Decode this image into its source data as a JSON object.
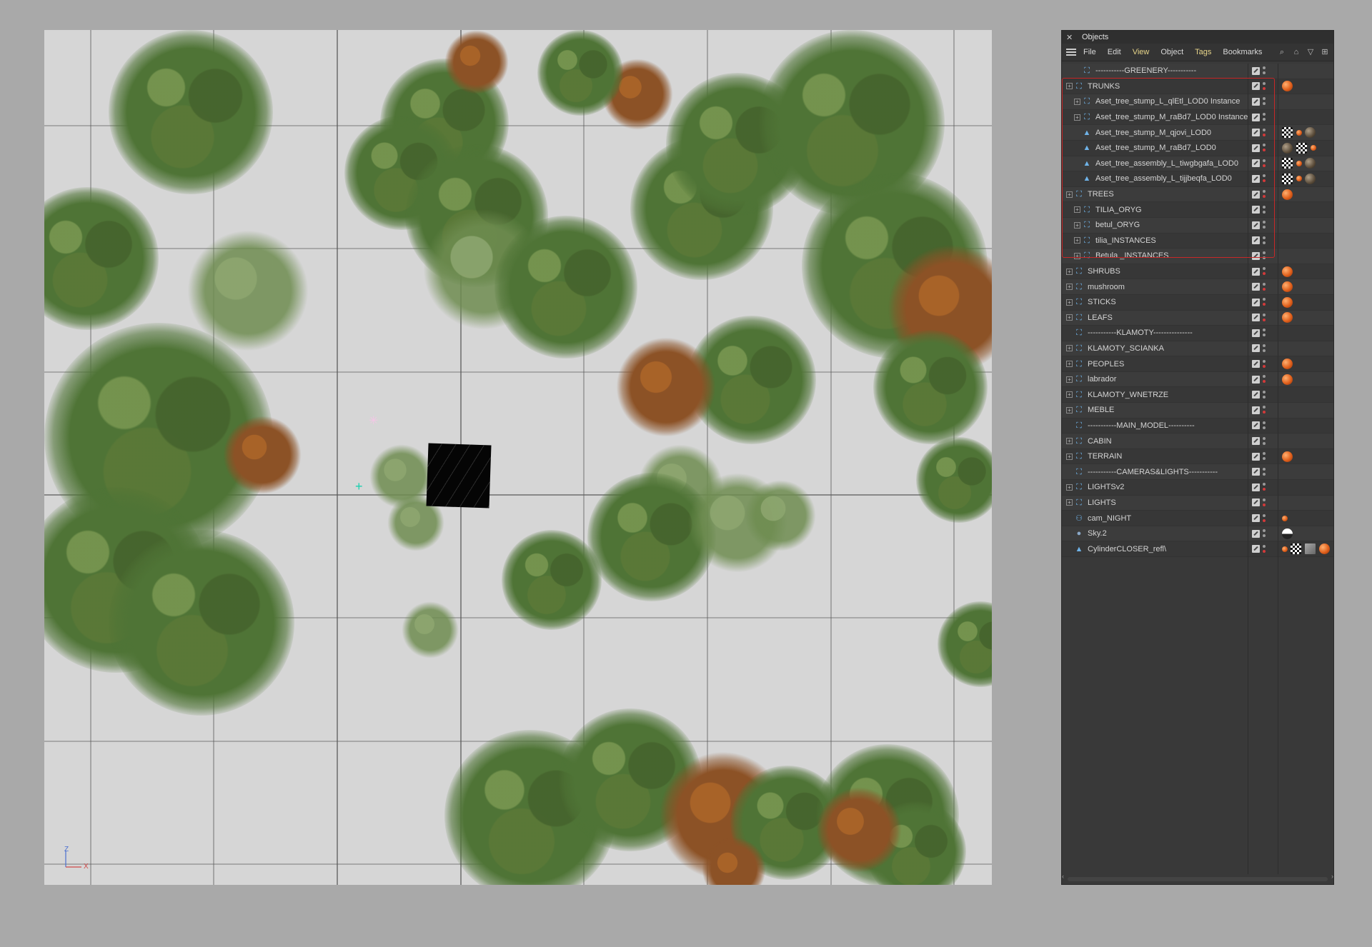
{
  "panel": {
    "title": "Objects",
    "close_glyph": "✕",
    "menu": [
      "File",
      "Edit",
      "View",
      "Object",
      "Tags",
      "Bookmarks"
    ],
    "active_menus": [
      "View",
      "Tags"
    ],
    "tool_icons": [
      "search-icon",
      "home-icon",
      "filter-icon",
      "new-window-icon"
    ],
    "objects": [
      {
        "name": "-----------GREENERY-----------",
        "indent": 1,
        "expander": false,
        "icon": "null-icon",
        "tags": []
      },
      {
        "name": "TRUNKS",
        "indent": 0,
        "expander": true,
        "icon": "null-icon",
        "tags": [
          "orange"
        ],
        "red": true
      },
      {
        "name": "Aset_tree_stump_L_qlEtl_LOD0 Instance",
        "indent": 1,
        "expander": true,
        "icon": "null-icon",
        "tags": []
      },
      {
        "name": "Aset_tree_stump_M_raBd7_LOD0 Instance",
        "indent": 1,
        "expander": true,
        "icon": "null-icon",
        "tags": []
      },
      {
        "name": "Aset_tree_stump_M_qjovi_LOD0",
        "indent": 1,
        "expander": false,
        "icon": "polygon-icon",
        "tags": [
          "checker",
          "tiny-orange",
          "sphere"
        ],
        "red": true
      },
      {
        "name": "Aset_tree_stump_M_raBd7_LOD0",
        "indent": 1,
        "expander": false,
        "icon": "polygon-icon",
        "tags": [
          "sphere",
          "checker",
          "tiny-orange"
        ],
        "red": true
      },
      {
        "name": "Aset_tree_assembly_L_tiwgbgafa_LOD0",
        "indent": 1,
        "expander": false,
        "icon": "polygon-icon",
        "tags": [
          "checker",
          "tiny-orange",
          "sphere"
        ],
        "red": true
      },
      {
        "name": "Aset_tree_assembly_L_tijjbeqfa_LOD0",
        "indent": 1,
        "expander": false,
        "icon": "polygon-icon",
        "tags": [
          "checker",
          "tiny-orange",
          "sphere"
        ],
        "red": true
      },
      {
        "name": "TREES",
        "indent": 0,
        "expander": true,
        "icon": "null-icon",
        "tags": [
          "orange"
        ],
        "red": true
      },
      {
        "name": "TILIA_ORYG",
        "indent": 1,
        "expander": true,
        "icon": "null-icon",
        "tags": []
      },
      {
        "name": "betul_ORYG",
        "indent": 1,
        "expander": true,
        "icon": "null-icon",
        "tags": []
      },
      {
        "name": "tilia_INSTANCES",
        "indent": 1,
        "expander": true,
        "icon": "null-icon",
        "tags": []
      },
      {
        "name": "Betula _INSTANCES",
        "indent": 1,
        "expander": true,
        "icon": "null-icon",
        "tags": []
      },
      {
        "name": "SHRUBS",
        "indent": 0,
        "expander": true,
        "icon": "null-icon",
        "tags": [
          "orange"
        ],
        "red": true
      },
      {
        "name": "mushroom",
        "indent": 0,
        "expander": true,
        "icon": "null-icon",
        "tags": [
          "orange"
        ],
        "red": true
      },
      {
        "name": "STICKS",
        "indent": 0,
        "expander": true,
        "icon": "null-icon",
        "tags": [
          "orange"
        ],
        "red": true
      },
      {
        "name": "LEAFS",
        "indent": 0,
        "expander": true,
        "icon": "null-icon",
        "tags": [
          "orange"
        ],
        "red": true
      },
      {
        "name": "-----------KLAMOTY---------------",
        "indent": 0,
        "expander": false,
        "icon": "null-icon",
        "tags": []
      },
      {
        "name": "KLAMOTY_SCIANKA",
        "indent": 0,
        "expander": true,
        "icon": "null-icon",
        "tags": []
      },
      {
        "name": "PEOPLES",
        "indent": 0,
        "expander": true,
        "icon": "null-icon",
        "tags": [
          "orange"
        ],
        "red": true
      },
      {
        "name": "labrador",
        "indent": 0,
        "expander": true,
        "icon": "null-icon",
        "tags": [
          "orange"
        ],
        "red": true
      },
      {
        "name": "KLAMOTY_WNETRZE",
        "indent": 0,
        "expander": true,
        "icon": "null-icon",
        "tags": []
      },
      {
        "name": "MEBLE",
        "indent": 0,
        "expander": true,
        "icon": "null-icon",
        "tags": [],
        "red": true
      },
      {
        "name": "-----------MAIN_MODEL----------",
        "indent": 0,
        "expander": false,
        "icon": "null-icon",
        "tags": []
      },
      {
        "name": "CABIN",
        "indent": 0,
        "expander": true,
        "icon": "null-icon",
        "tags": []
      },
      {
        "name": "TERRAIN",
        "indent": 0,
        "expander": true,
        "icon": "null-icon",
        "tags": [
          "orange"
        ]
      },
      {
        "name": "-----------CAMERAS&LIGHTS-----------",
        "indent": 0,
        "expander": false,
        "icon": "null-icon",
        "tags": []
      },
      {
        "name": "LIGHTSv2",
        "indent": 0,
        "expander": true,
        "icon": "null-icon",
        "tags": [],
        "red": true
      },
      {
        "name": "LIGHTS",
        "indent": 0,
        "expander": true,
        "icon": "null-icon",
        "tags": [],
        "red": true
      },
      {
        "name": "cam_NIGHT",
        "indent": 0,
        "expander": false,
        "icon": "camera-icon",
        "tags": [
          "camera-tag"
        ],
        "red": true
      },
      {
        "name": "Sky.2",
        "indent": 0,
        "expander": false,
        "icon": "sky-icon",
        "tags": [
          "sky"
        ]
      },
      {
        "name": "CylinderCLOSER_refl\\",
        "indent": 0,
        "expander": false,
        "icon": "polygon-icon",
        "tags": [
          "tiny-orange",
          "checker",
          "grey",
          "orange"
        ],
        "red": true
      }
    ]
  },
  "viewport": {
    "axis_z": "Z",
    "axis_x": "X",
    "cyan_cross": "+",
    "light_star": "✳",
    "background": "#d6d6d6",
    "grid_color": "#5a5a5a"
  },
  "colors": {
    "selection": "#c82828",
    "active_menu": "#e7d58a",
    "panel_bg": "#393939"
  }
}
